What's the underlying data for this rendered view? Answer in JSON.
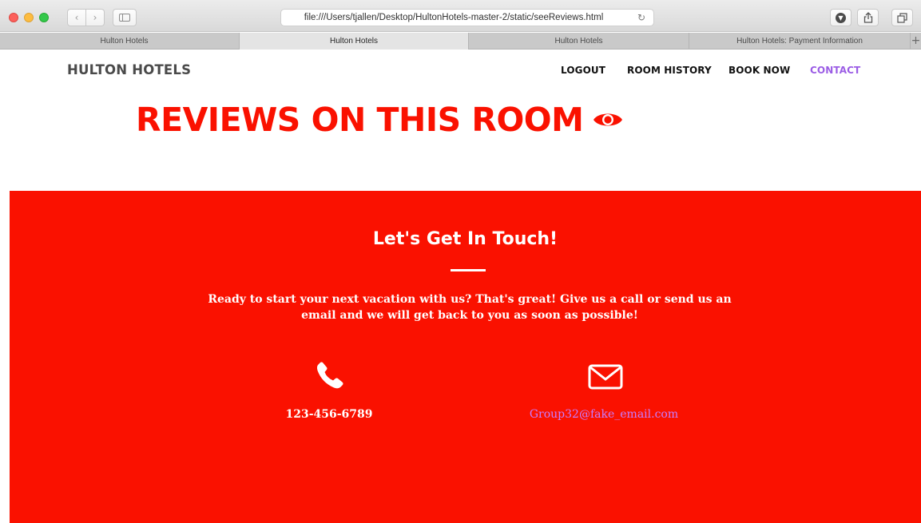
{
  "browser": {
    "address_url": "file:///Users/tjallen/Desktop/HultonHotels-master-2/static/seeReviews.html",
    "icons": {
      "back": "chevron-left-icon",
      "forward": "chevron-right-icon",
      "sidebar": "sidebar-icon",
      "reload": "reload-icon",
      "download": "download-icon",
      "share": "share-icon",
      "tabs": "tab-overview-icon",
      "new_tab": "plus-icon"
    },
    "tabs": [
      {
        "label": "Hulton Hotels",
        "active": false
      },
      {
        "label": "Hulton Hotels",
        "active": true
      },
      {
        "label": "Hulton Hotels",
        "active": false
      },
      {
        "label": "Hulton Hotels: Payment Information",
        "active": false
      }
    ]
  },
  "site": {
    "brand": "HULTON HOTELS",
    "nav": {
      "logout": "LOGOUT",
      "room_history": "ROOM HISTORY",
      "book_now": "BOOK NOW",
      "contact": "CONTACT"
    },
    "page_title": "REVIEWS ON THIS ROOM",
    "title_icon": "eye-icon",
    "colors": {
      "accent_red": "#fa1100",
      "contact_link": "#9b5de5",
      "email_link": "#c77dff"
    }
  },
  "contact": {
    "heading": "Let's Get In Touch!",
    "text": "Ready to start your next vacation with us? That's great! Give us a call or send us an email and we will get back to you as soon as possible!",
    "phone": "123-456-6789",
    "email": "Group32@fake_email.com",
    "icons": {
      "phone": "phone-icon",
      "email": "envelope-icon"
    }
  }
}
